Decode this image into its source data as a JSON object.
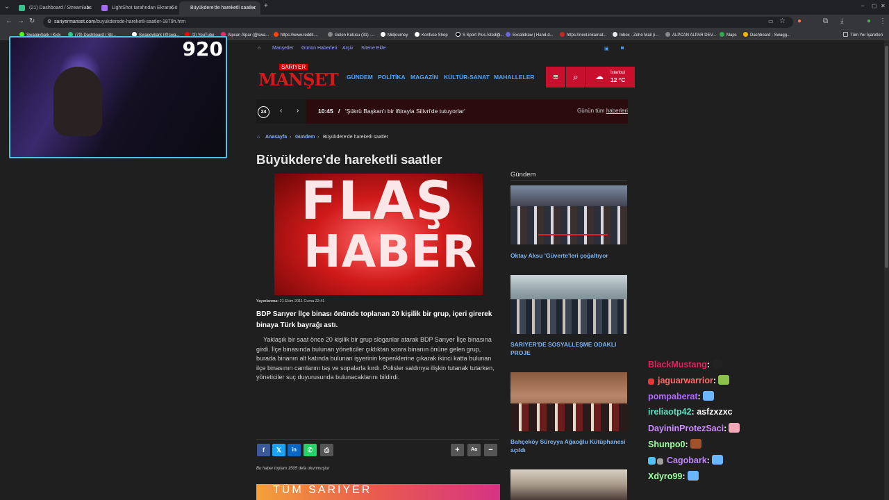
{
  "tabs": [
    {
      "label": "(21) Dashboard / Streamlabs",
      "color": "#31c48d"
    },
    {
      "label": "LightShot tarafından Ekran Gö",
      "color": "#a36cf0"
    },
    {
      "label": "Büyükdere'de hareketli saatler",
      "color": "#202124"
    }
  ],
  "url": {
    "host": "sariyermanset.com",
    "path": "/buyukderede-hareketli-saatler-1879h.htm"
  },
  "bookmarks": [
    "Swaggybark | Kick",
    "(79) Dashboard / Str...",
    "Swaggybark (@swa...",
    "(2) YouTube",
    "Alpcan Alpar (@swa...",
    "https://www.reddit....",
    "Gelen Kutusu (31) -...",
    "Midjourney",
    "Konfuse Shop",
    "S Sport Plus-İstediği...",
    "Excalidraw | Hand-d...",
    "https://next.inkarnat...",
    "Inbox - Zoho Mail (i...",
    "ALPCAN ALPAR DEV...",
    "Maps",
    "Dashboard - Swagg..."
  ],
  "bookmarks_all": "Tüm Yer İşaretleri",
  "webcam": {
    "viewer_count": "920"
  },
  "site": {
    "topnav": [
      "Manşetler",
      "Günün Haberleri",
      "Arşiv",
      "Sitene Ekle"
    ],
    "logo_top": "SARIYER",
    "logo_main": "MANŞET",
    "menu": [
      "GÜNDEM",
      "POLİTİKA",
      "MAGAZİN",
      "KÜLTÜR-SANAT",
      "MAHALLELER"
    ],
    "weather": {
      "city": "İstanbul",
      "temp": "12 °C"
    },
    "ticker": {
      "badge": "24",
      "time": "10:45",
      "sep": "/",
      "text": "'Şükrü Başkan'ı bir iftirayla Silivri'de tutuyorlar'",
      "all_prefix": "Günün tüm",
      "all_link": "haberleri"
    }
  },
  "breadcrumb": [
    "Anasayfa",
    "Gündem",
    "Büyükdere'de hareketli saatler"
  ],
  "article": {
    "title": "Büyükdere'de hareketli saatler",
    "image_text_1": "FLAŞ",
    "image_text_2": "HABER!",
    "published_label": "Yayınlanma:",
    "published_date": "21 Ekim 2011 Cuma 22:41",
    "lead": "BDP Sarıyer İlçe binası önünde toplanan 20 kişilik bir grup, içeri girerek binaya Türk bayrağı astı.",
    "body": "Yaklaşık bir saat önce 20 kişilik bir grup sloganlar atarak BDP Sarıyer İlçe binasına girdi. İlçe binasında bulunan yöneticiler çıktıktan sonra binanın önüne gelen grup, burada binanın alt katında bulunan işyerinin kepenklerine çıkarak ikinci katta bulunan ilçe binasının camlarını taş ve sopalarla kırdı. Polisler saldırıya ilişkin tutanak tutarken, yöneticiler suç duyurusunda bulunacaklarını bildirdi.",
    "views": "Bu haber toplam 1505 defa okunmuştur",
    "banner": "TÜM SARIYER"
  },
  "share": [
    {
      "label": "f",
      "color": "#3b5998"
    },
    {
      "label": "𝕏",
      "color": "#1da1f2"
    },
    {
      "label": "in",
      "color": "#0a66c2"
    },
    {
      "label": "✆",
      "color": "#25d366"
    },
    {
      "label": "⎙",
      "color": "#555555"
    }
  ],
  "font_tools": [
    "+",
    "Aa",
    "−"
  ],
  "sidebar": {
    "heading": "Gündem",
    "items": [
      {
        "caption": "Oktay Aksu 'Güverte'leri çoğaltıyor"
      },
      {
        "caption": "SARIYER'DE SOSYALLEŞME ODAKLI PROJE"
      },
      {
        "caption": "Bahçeköy Süreyya Ağaoğlu Kütüphanesi açıldı"
      },
      {
        "caption": ""
      }
    ]
  },
  "chat": [
    {
      "user": "BlackMustang",
      "sep": ":",
      "msg": "",
      "color": "#e0245e"
    },
    {
      "user": "jaguarwarrior",
      "sep": ":",
      "msg": "",
      "color": "#ff6b6b"
    },
    {
      "user": "pompaberat",
      "sep": ":",
      "msg": "",
      "color": "#b36bff"
    },
    {
      "user": "ireliaotp42",
      "sep": ":",
      "msg": "asfzxzxc",
      "color": "#5ee0c0"
    },
    {
      "user": "DayininProtezSaci",
      "sep": ":",
      "msg": "",
      "color": "#d08bff"
    },
    {
      "user": "Shunpo0",
      "sep": ":",
      "msg": "",
      "color": "#9effa0"
    },
    {
      "user": "Cagobark",
      "sep": ":",
      "msg": "",
      "color": "#c084fc"
    },
    {
      "user": "Xdyro99",
      "sep": ":",
      "msg": "",
      "color": "#9effa0"
    }
  ]
}
